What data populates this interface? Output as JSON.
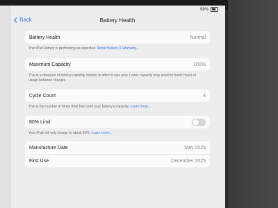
{
  "status_bar": {
    "battery_percent": "98%"
  },
  "nav": {
    "back_label": "Back",
    "title": "Battery Health"
  },
  "battery_health": {
    "label": "Battery Health",
    "value": "Normal",
    "note": "This iPad battery is performing as expected.",
    "link": "About Battery & Warranty..."
  },
  "maximum_capacity": {
    "label": "Maximum Capacity",
    "value": "100%",
    "note": "This is a measure of battery capacity relative to when it was new. Lower capacity may result in fewer hours of usage between charges."
  },
  "cycle_count": {
    "label": "Cycle Count",
    "value": "4",
    "note": "This is the number of times iPad has used your battery's capacity.",
    "link": "Learn more..."
  },
  "limit_80": {
    "label": "80% Limit",
    "enabled": false,
    "note": "Your iPad will only charge to about 80%.",
    "link": "Learn more..."
  },
  "dates": [
    {
      "label": "Manufacture Date",
      "value": "May 2025"
    },
    {
      "label": "First Use",
      "value": "December 2025"
    }
  ]
}
